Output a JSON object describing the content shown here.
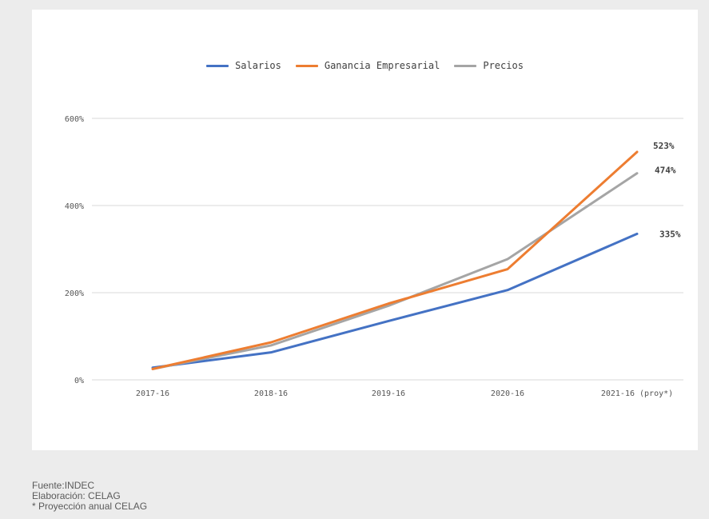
{
  "chart_data": {
    "type": "line",
    "title": "",
    "xlabel": "",
    "ylabel": "",
    "categories": [
      "2017-16",
      "2018-16",
      "2019-16",
      "2020-16",
      "2021-16 (proy*)"
    ],
    "y_ticks": [
      0,
      200,
      400,
      600
    ],
    "y_tick_labels": [
      "0%",
      "200%",
      "400%",
      "600%"
    ],
    "ylim": [
      0,
      600
    ],
    "grid": true,
    "legend_position": "top-center",
    "series": [
      {
        "name": "Salarios",
        "color": "#4472c4",
        "values": [
          28,
          63,
          135,
          206,
          335
        ],
        "end_label": "335%"
      },
      {
        "name": "Ganancia Empresarial",
        "color": "#ed7d31",
        "values": [
          25,
          86,
          175,
          254,
          523
        ],
        "end_label": "523%"
      },
      {
        "name": "Precios",
        "color": "#a5a5a5",
        "values": [
          25,
          79,
          170,
          277,
          474
        ],
        "end_label": "474%"
      }
    ]
  },
  "footer": {
    "source": "Fuente:INDEC",
    "elaboration": "Elaboración: CELAG",
    "projection_note": "* Proyección anual CELAG"
  }
}
